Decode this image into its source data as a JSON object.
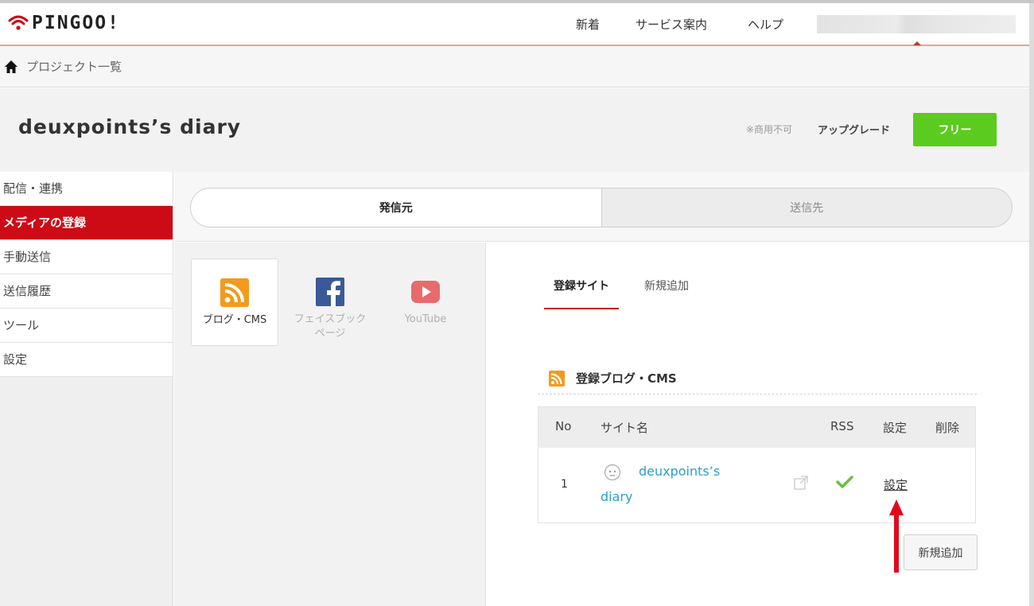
{
  "header": {
    "logo_text": "PINGOO!",
    "nav": [
      "新着",
      "サービス案内",
      "ヘルプ"
    ],
    "brand_color": "#cc0b16"
  },
  "breadcrumb": {
    "label": "プロジェクト一覧"
  },
  "project": {
    "title": "deuxpoints’s diary",
    "note": "※商用不可",
    "upgrade_label": "アップグレード",
    "plan_label": "フリー",
    "plan_color": "#5ccb1f"
  },
  "sidebar": {
    "items": [
      {
        "label": "配信・連携",
        "active": false
      },
      {
        "label": "メディアの登録",
        "active": true
      },
      {
        "label": "手動送信",
        "active": false
      },
      {
        "label": "送信履歴",
        "active": false
      },
      {
        "label": "ツール",
        "active": false
      },
      {
        "label": "設定",
        "active": false
      }
    ]
  },
  "segment": {
    "tabs": [
      "発信元",
      "送信先"
    ],
    "selected": "発信元"
  },
  "media": {
    "cards": [
      {
        "label": "ブログ・CMS",
        "icon": "rss-icon",
        "selected": true
      },
      {
        "label": "フェイスブック\nページ",
        "icon": "facebook-icon",
        "selected": false
      },
      {
        "label": "YouTube",
        "icon": "youtube-icon",
        "selected": false
      }
    ]
  },
  "panel": {
    "subtabs": [
      "登録サイト",
      "新規追加"
    ],
    "section_title": "登録ブログ・CMS",
    "table": {
      "headers": [
        "No",
        "サイト名",
        "RSS",
        "設定",
        "削除"
      ],
      "rows": [
        {
          "no": "1",
          "site_line1": "deuxpoints’s",
          "site_line2": "diary",
          "rss": "check-icon",
          "setting": "設定"
        }
      ]
    },
    "add_button": "新規追加"
  }
}
